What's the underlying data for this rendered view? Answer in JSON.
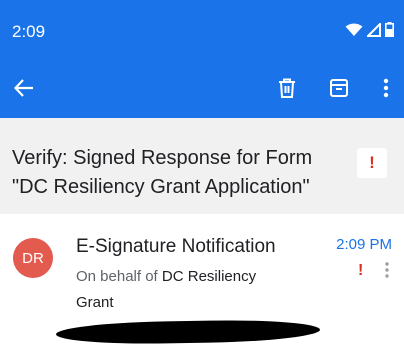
{
  "status_bar": {
    "time": "2:09"
  },
  "app_bar": {
    "icons": [
      "back-arrow-icon",
      "delete-icon",
      "archive-icon",
      "more-vert-icon"
    ]
  },
  "subject": {
    "line1": "Verify: Signed Response for Form",
    "line2": "\"DC Resiliency Grant Application\""
  },
  "message": {
    "avatar_initials": "DR",
    "sender": "E-Signature Notification",
    "behalf_prefix": "On behalf of",
    "behalf_org": "DC Resiliency",
    "behalf_org_cont": "Grant",
    "time": "2:09 PM",
    "flag_glyph": "!"
  },
  "colors": {
    "accent": "#1a73e8",
    "avatar": "#e35a4f",
    "flag": "#d93025",
    "subject_bg": "#f1f1f1"
  }
}
